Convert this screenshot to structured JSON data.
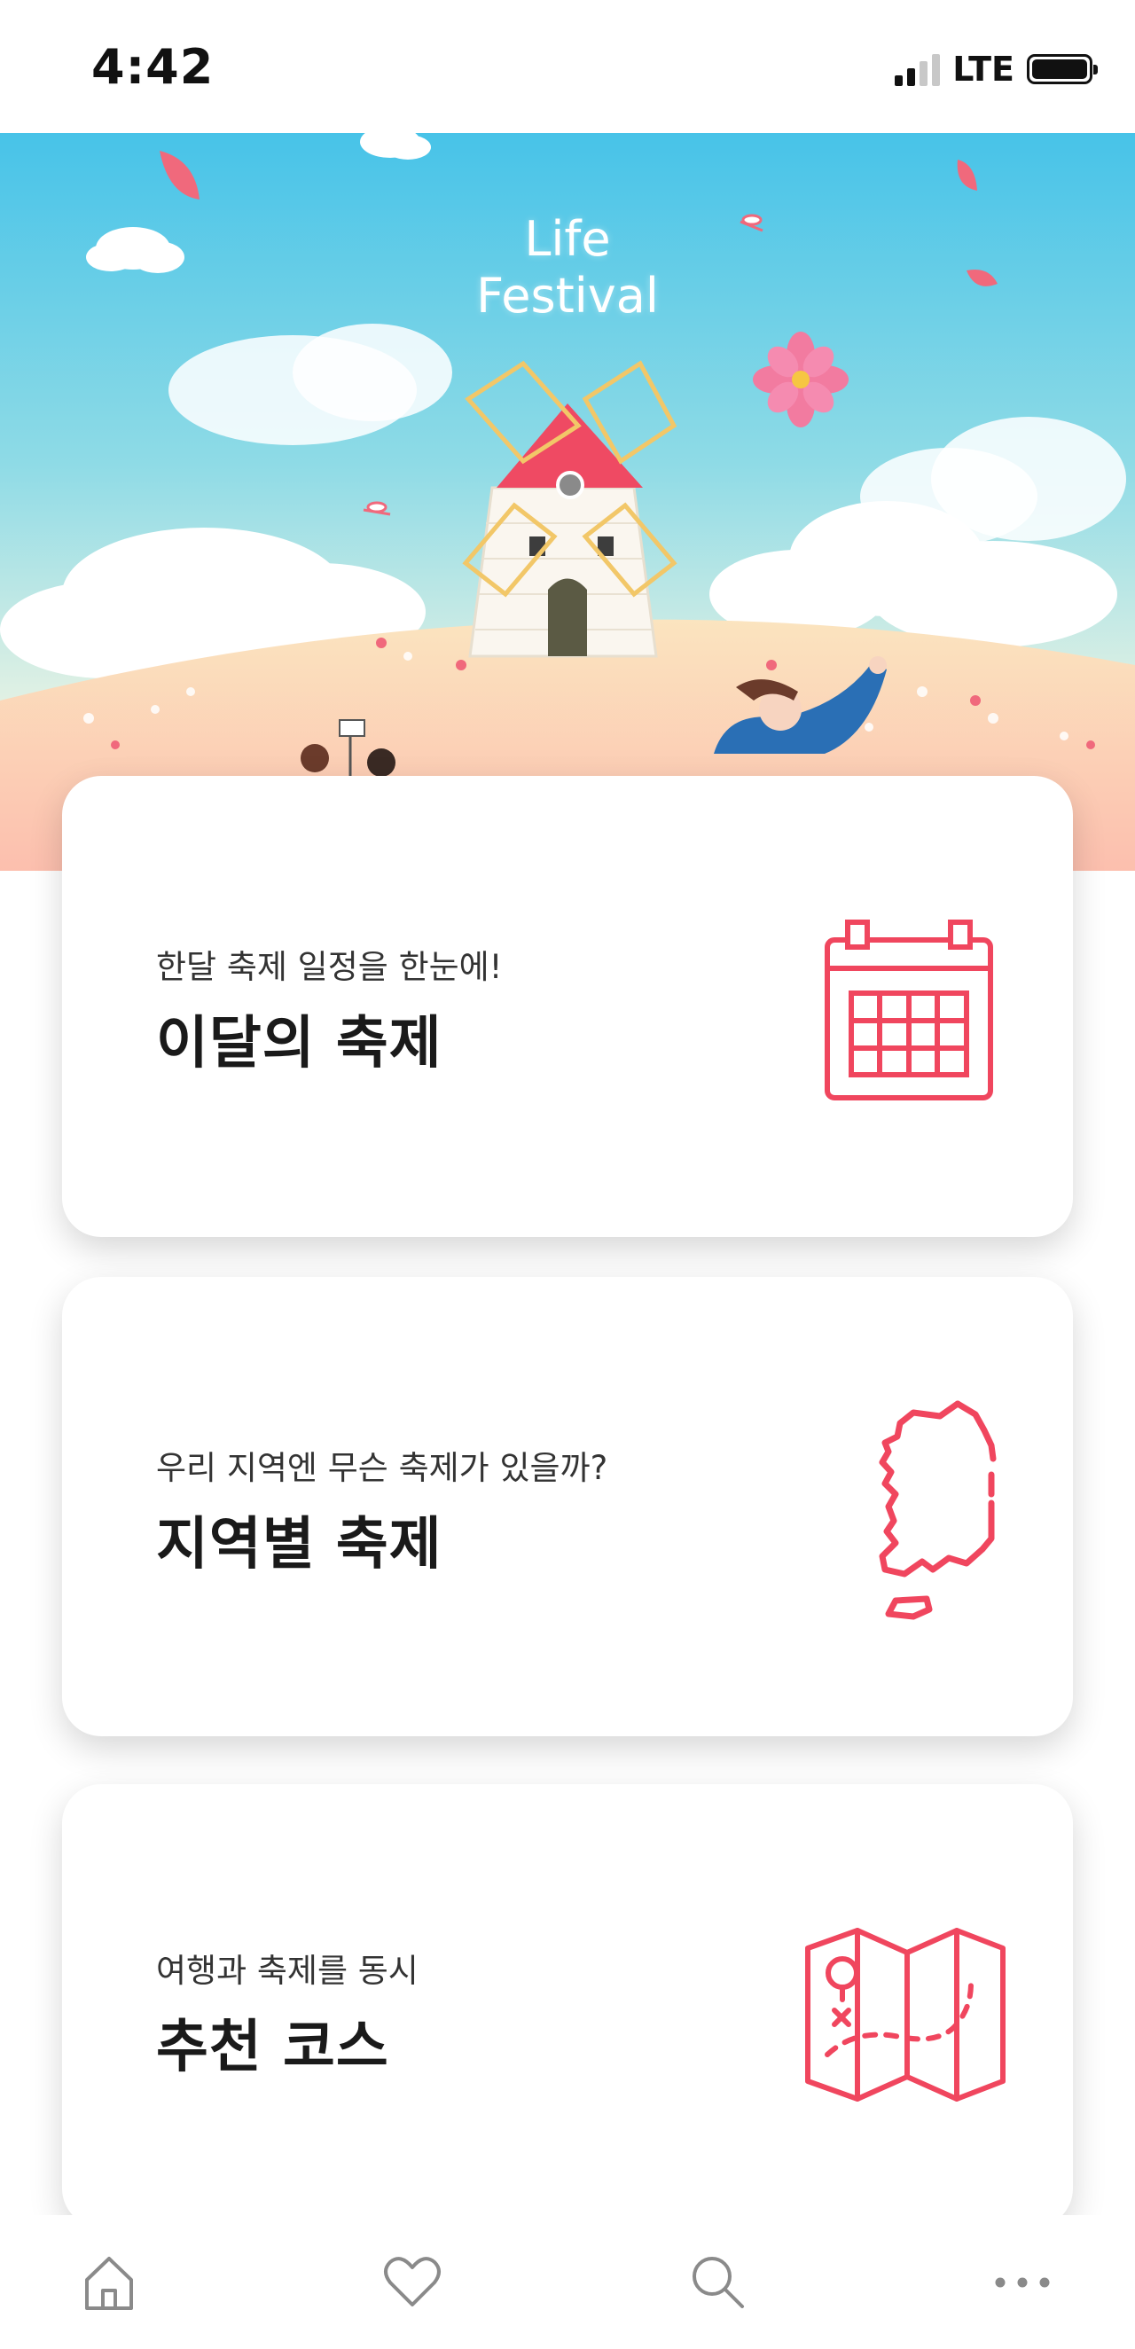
{
  "status_bar": {
    "time": "4:42",
    "network": "LTE"
  },
  "hero": {
    "title_line1": "Life",
    "title_line2": "Festival"
  },
  "cards": [
    {
      "subtitle": "한달 축제 일정을 한눈에!",
      "title": "이달의 축제",
      "icon": "calendar-icon"
    },
    {
      "subtitle": "우리 지역엔 무슨 축제가 있을까?",
      "title": "지역별 축제",
      "icon": "korea-map-icon"
    },
    {
      "subtitle": "여행과 축제를 동시",
      "title": "추천 코스",
      "icon": "folded-map-icon"
    }
  ],
  "tab_bar": {
    "tabs": [
      "home-icon",
      "heart-icon",
      "search-icon",
      "more-icon"
    ]
  },
  "colors": {
    "accent": "#f0465e",
    "sky_top": "#47c3e8",
    "sand": "#fbd9b8"
  }
}
